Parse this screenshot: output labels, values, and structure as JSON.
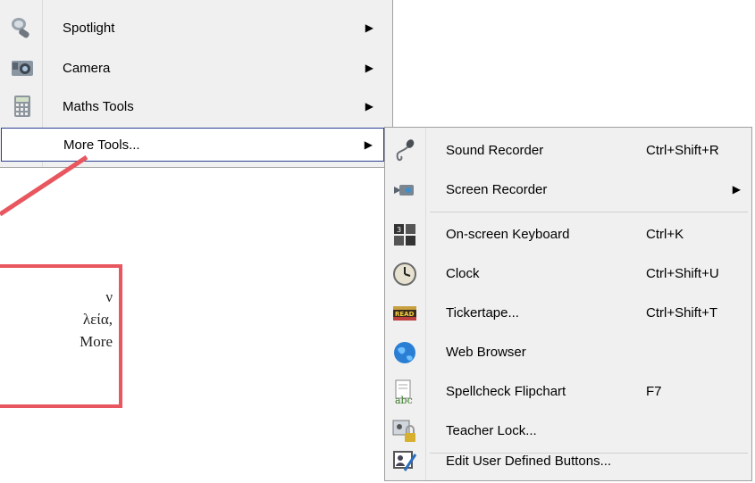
{
  "main_menu": {
    "items": [
      {
        "label": "Spotlight",
        "icon": "spotlight-icon",
        "has_submenu": true
      },
      {
        "label": "Camera",
        "icon": "camera-icon",
        "has_submenu": true
      },
      {
        "label": "Maths Tools",
        "icon": "calculator-icon",
        "has_submenu": true
      },
      {
        "label": "More Tools...",
        "icon": "",
        "has_submenu": true,
        "active": true
      }
    ]
  },
  "submenu": {
    "items": [
      {
        "label": "Sound Recorder",
        "shortcut": "Ctrl+Shift+R",
        "icon": "microphone-icon"
      },
      {
        "label": "Screen Recorder",
        "shortcut": "",
        "icon": "video-camera-icon",
        "has_submenu": true
      },
      {
        "label": "On-screen Keyboard",
        "shortcut": "Ctrl+K",
        "icon": "keyboard-icon"
      },
      {
        "label": "Clock",
        "shortcut": "Ctrl+Shift+U",
        "icon": "clock-icon"
      },
      {
        "label": "Tickertape...",
        "shortcut": "Ctrl+Shift+T",
        "icon": "tickertape-icon"
      },
      {
        "label": "Web Browser",
        "shortcut": "",
        "icon": "globe-icon"
      },
      {
        "label": "Spellcheck Flipchart",
        "shortcut": "F7",
        "icon": "spellcheck-icon"
      },
      {
        "label": "Teacher Lock...",
        "shortcut": "",
        "icon": "padlock-icon"
      },
      {
        "label": "Edit User Defined Buttons...",
        "shortcut": "",
        "icon": "edit-user-icon"
      }
    ]
  },
  "callout": {
    "line1": "ν",
    "line2": "λεία,",
    "line3": "More"
  },
  "colors": {
    "menu_bg": "#f0f0f0",
    "active_border": "#2a3f8f",
    "callout_red": "#e8575f"
  }
}
